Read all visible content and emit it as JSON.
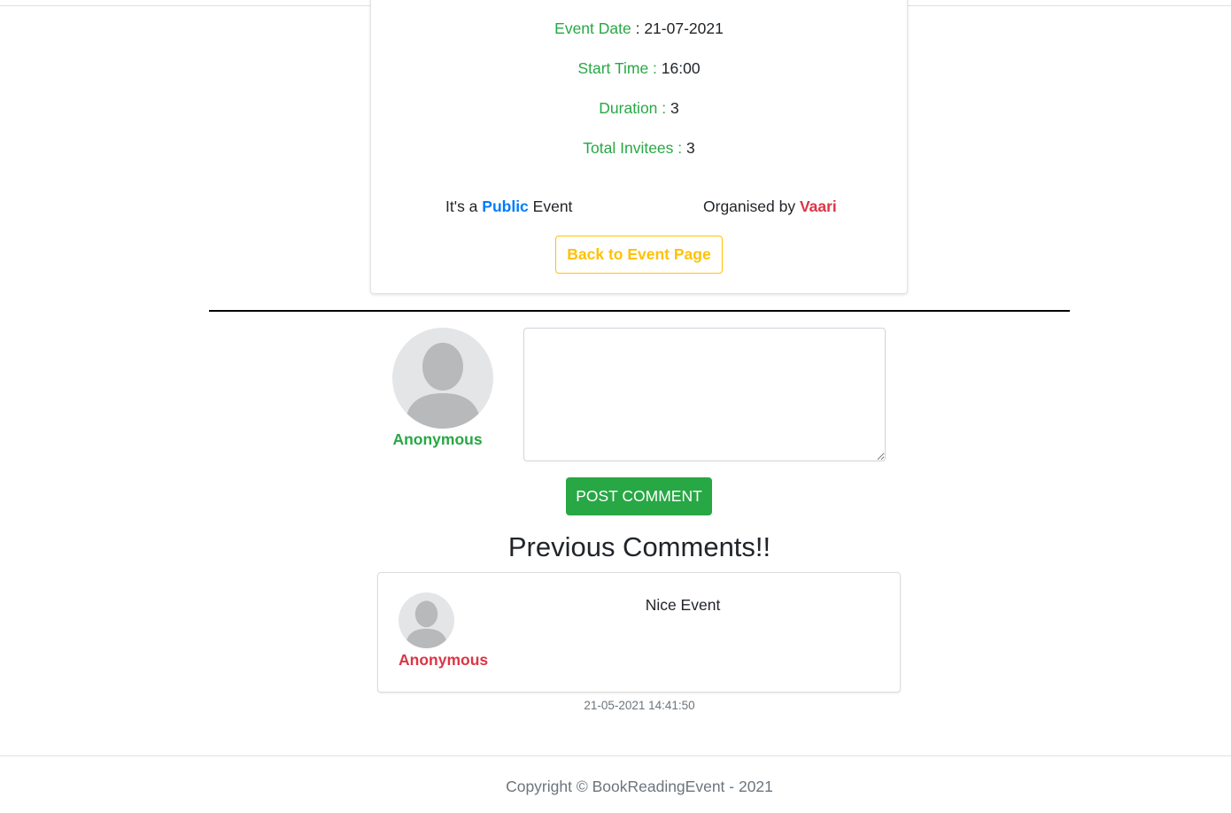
{
  "event": {
    "details": [
      {
        "label": "Event Date",
        "sep": " : ",
        "value": "21-07-2021"
      },
      {
        "label": "Start Time : ",
        "sep": "",
        "value": "16:00"
      },
      {
        "label": "Duration : ",
        "sep": "",
        "value": "3"
      },
      {
        "label": "Total Invitees : ",
        "sep": "",
        "value": "3"
      }
    ],
    "visibility_prefix": "It's a ",
    "visibility": "Public",
    "visibility_suffix": " Event",
    "organiser_prefix": "Organised by ",
    "organiser": "Vaari",
    "back_button": "Back to Event Page"
  },
  "comment_form": {
    "user_name": "Anonymous",
    "textarea_value": "",
    "post_button": "POST COMMENT",
    "avatar_icon": "user-avatar-icon"
  },
  "previous_comments": {
    "title": "Previous Comments!!",
    "items": [
      {
        "author": "Anonymous",
        "text": "Nice Event",
        "timestamp": "21-05-2021 14:41:50"
      }
    ]
  },
  "footer": {
    "copyright": "Copyright © BookReadingEvent - 2021"
  },
  "colors": {
    "green": "#28a745",
    "red": "#dc3545",
    "blue": "#007bff",
    "yellow": "#ffc107",
    "muted": "#6c757d"
  }
}
